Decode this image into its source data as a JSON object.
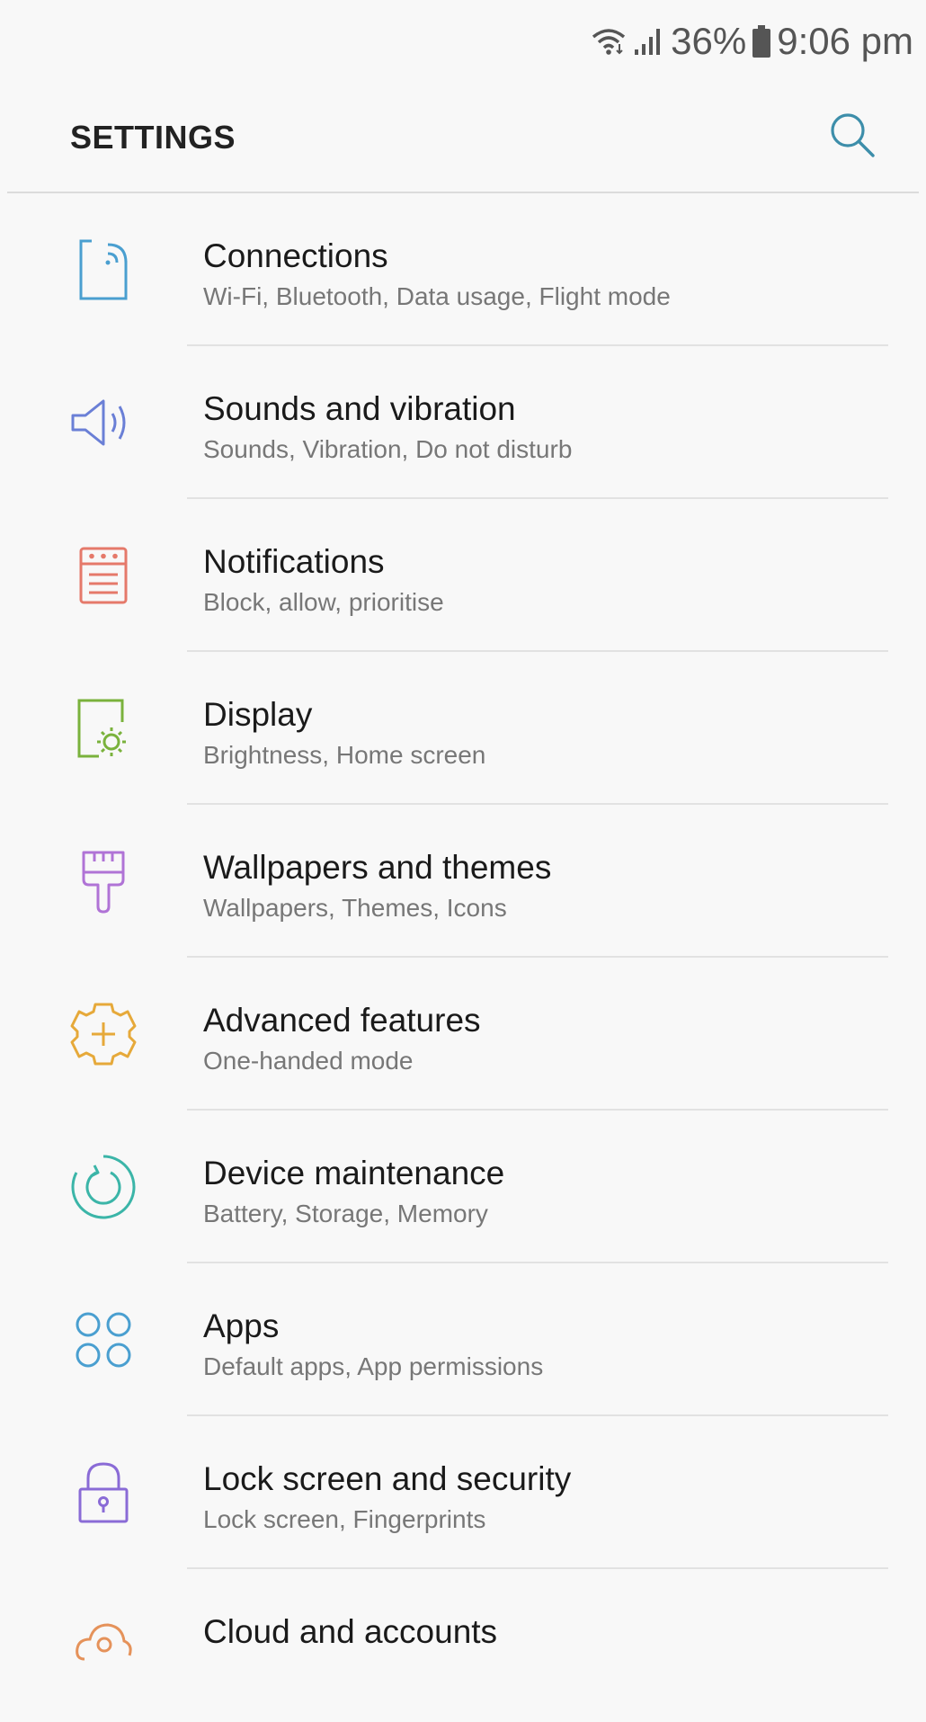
{
  "status_bar": {
    "battery_percent": "36%",
    "time": "9:06 pm",
    "icons": [
      "wifi-icon",
      "signal-icon",
      "battery-icon"
    ]
  },
  "header": {
    "title": "SETTINGS",
    "search_icon": "search-icon",
    "accent_color": "#3d8eaa"
  },
  "items": [
    {
      "title": "Connections",
      "subtitle": "Wi-Fi, Bluetooth, Data usage, Flight mode",
      "icon": "connections-icon",
      "color": "#4a9fd0"
    },
    {
      "title": "Sounds and vibration",
      "subtitle": "Sounds, Vibration, Do not disturb",
      "icon": "speaker-icon",
      "color": "#6a7fd6"
    },
    {
      "title": "Notifications",
      "subtitle": "Block, allow, prioritise",
      "icon": "notifications-icon",
      "color": "#e5796a"
    },
    {
      "title": "Display",
      "subtitle": "Brightness, Home screen",
      "icon": "display-icon",
      "color": "#7ab23c"
    },
    {
      "title": "Wallpapers and themes",
      "subtitle": "Wallpapers, Themes, Icons",
      "icon": "paintbrush-icon",
      "color": "#b073d6"
    },
    {
      "title": "Advanced features",
      "subtitle": "One-handed mode",
      "icon": "advanced-gear-icon",
      "color": "#e6a93a"
    },
    {
      "title": "Device maintenance",
      "subtitle": "Battery, Storage, Memory",
      "icon": "maintenance-icon",
      "color": "#3bb5a8"
    },
    {
      "title": "Apps",
      "subtitle": "Default apps, App permissions",
      "icon": "apps-icon",
      "color": "#4a9fd0"
    },
    {
      "title": "Lock screen and security",
      "subtitle": "Lock screen, Fingerprints",
      "icon": "lock-icon",
      "color": "#8a6bd6"
    },
    {
      "title": "Cloud and accounts",
      "subtitle": "",
      "icon": "cloud-key-icon",
      "color": "#e5925a"
    }
  ]
}
